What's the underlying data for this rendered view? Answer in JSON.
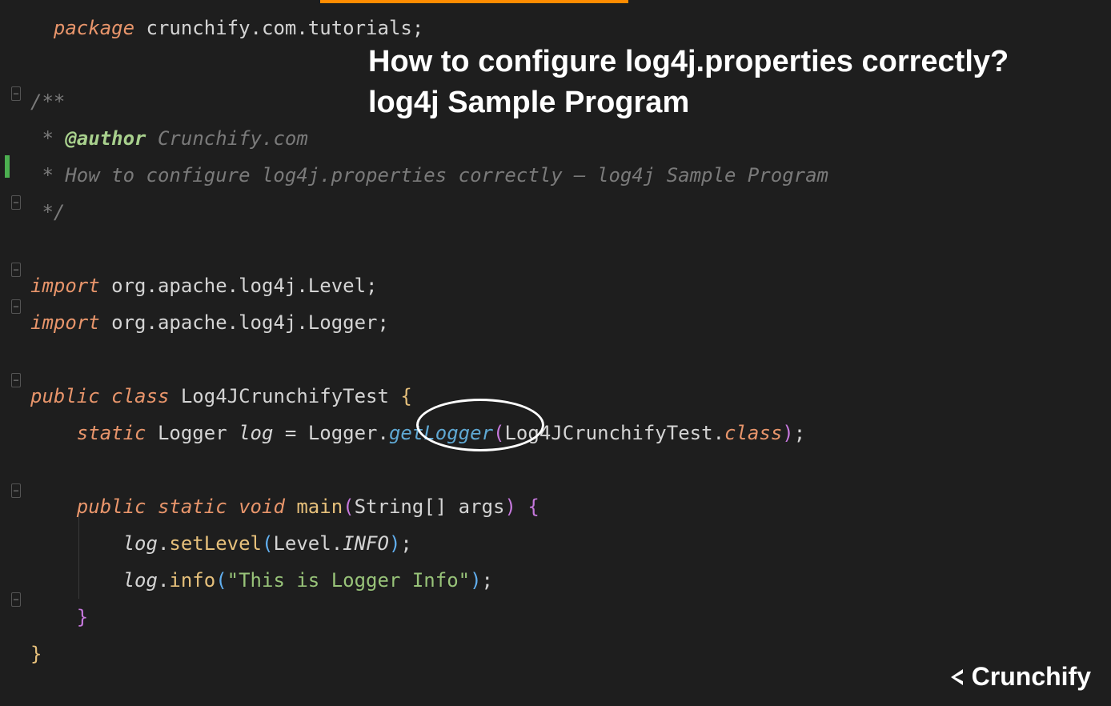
{
  "overlay": {
    "title_line1": "How to configure log4j.properties correctly?",
    "title_line2": "log4j Sample Program"
  },
  "code": {
    "package_kw": "package",
    "package_name": " crunchify.com.tutorials",
    "semicolon": ";",
    "doc_open": "/**",
    "doc_prefix": " * ",
    "author_tag": "@author",
    "author_name": " Crunchify.com",
    "doc_desc": " * How to configure log4j.properties correctly – log4j Sample Program",
    "doc_close": " */",
    "import_kw": "import",
    "import1": " org.apache.log4j.Level",
    "import2": " org.apache.log4j.Logger",
    "public_kw": "public",
    "class_kw": "class",
    "class_name": " Log4JCrunchifyTest ",
    "brace_open": "{",
    "brace_close": "}",
    "static_kw": "static",
    "logger_type": " Logger ",
    "log_var": "log",
    "equals": " = ",
    "logger_class": "Logger",
    "dot": ".",
    "getLogger": "getLogger",
    "paren_open": "(",
    "paren_close": ")",
    "test_class": "Log4JCrunchifyTest",
    "class_ref": "class",
    "void_kw": "void",
    "main_method": " main",
    "string_type": "String",
    "brackets": "[]",
    "args": " args",
    "setLevel": "setLevel",
    "level_class": "Level",
    "info_const": "INFO",
    "info_method": "info",
    "info_string": "\"This is Logger Info\""
  },
  "logo": {
    "text": "Crunchify"
  }
}
